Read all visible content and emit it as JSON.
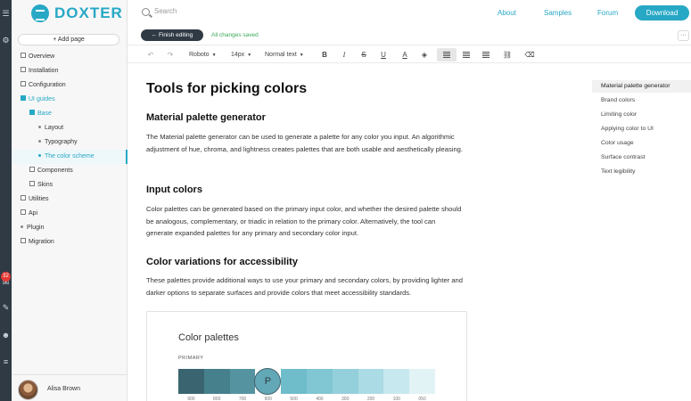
{
  "app": {
    "brand": "DOXTER"
  },
  "rail": {
    "icons": [
      {
        "name": "menu-icon",
        "glyph": "☰"
      },
      {
        "name": "settings-icon",
        "glyph": "⚙"
      },
      {
        "name": "notifications-icon",
        "glyph": "✉"
      },
      {
        "name": "edit-icon",
        "glyph": "✎"
      },
      {
        "name": "users-icon",
        "glyph": "☻"
      },
      {
        "name": "sliders-icon",
        "glyph": "≡"
      }
    ],
    "badge": "32"
  },
  "sidebar": {
    "add_page": "+ Add page",
    "items": [
      {
        "label": "Overview",
        "kind": "box"
      },
      {
        "label": "Installation",
        "kind": "box"
      },
      {
        "label": "Configuration",
        "kind": "box"
      },
      {
        "label": "UI guides",
        "kind": "box-active",
        "state": "on"
      },
      {
        "label": "Base",
        "kind": "box-active",
        "state": "on"
      },
      {
        "label": "Layout",
        "kind": "dot"
      },
      {
        "label": "Typography",
        "kind": "dot"
      },
      {
        "label": "The color scheme",
        "kind": "dot",
        "state": "selected"
      },
      {
        "label": "Components",
        "kind": "box"
      },
      {
        "label": "Skins",
        "kind": "box"
      },
      {
        "label": "Utilities",
        "kind": "box"
      },
      {
        "label": "Api",
        "kind": "box"
      },
      {
        "label": "Plugin",
        "kind": "dot"
      },
      {
        "label": "Migration",
        "kind": "box"
      }
    ],
    "user": {
      "name": "Alisa Brown"
    }
  },
  "header": {
    "search_placeholder": "Search",
    "links": [
      "About",
      "Samples",
      "Forum"
    ],
    "download": "Download"
  },
  "subbar": {
    "finish": "← Finish editing",
    "saved": "All changes saved",
    "more": "···"
  },
  "toolbar": {
    "undo": "↶",
    "redo": "↷",
    "font": "Roboto",
    "size": "14px",
    "block": "Normal text",
    "bold": "B",
    "italic": "I",
    "strike": "S",
    "underline": "U",
    "color": "A",
    "fill": "◈",
    "link": "⛓",
    "eraser": "⌫"
  },
  "doc": {
    "title": "Tools for picking colors",
    "sections": [
      {
        "heading": "Material palette generator",
        "text": "The Material palette generator can be used to generate a palette for any color you input. An algorithmic adjustment of hue, chroma, and lightness creates palettes that are both usable and aesthetically pleasing."
      },
      {
        "heading": "Input colors",
        "text": "Color palettes can be generated based on the primary input color, and whether the desired palette should be analogous, complementary, or triadic in relation to the primary color. Alternatively, the tool can generate expanded palettes for any primary and secondary color input."
      },
      {
        "heading": "Color variations for accessibility",
        "text": "These palettes provide additional ways to use your primary and secondary colors, by providing lighter and darker options to separate surfaces and provide colors that meet accessibility standards."
      }
    ],
    "palette": {
      "title": "Color palettes",
      "subtitle": "PRIMARY",
      "primary_marker": "P",
      "swatches": [
        {
          "color": "#3a6470",
          "label": "900"
        },
        {
          "color": "#46808c",
          "label": "800"
        },
        {
          "color": "#5593a0",
          "label": "700"
        },
        {
          "color": "#62a8b6",
          "label": "600",
          "primary": true
        },
        {
          "color": "#6fbccb",
          "label": "500"
        },
        {
          "color": "#80c6d3",
          "label": "400"
        },
        {
          "color": "#94d0db",
          "label": "300"
        },
        {
          "color": "#abdbe4",
          "label": "200"
        },
        {
          "color": "#c7e8ee",
          "label": "100"
        },
        {
          "color": "#e2f3f6",
          "label": "050"
        }
      ]
    }
  },
  "toc": {
    "items": [
      {
        "label": "Material palette generator",
        "active": true
      },
      {
        "label": "Brand colors"
      },
      {
        "label": "Limiting color"
      },
      {
        "label": "Applying color to UI"
      },
      {
        "label": "Color usage"
      },
      {
        "label": "Surface contrast"
      },
      {
        "label": "Text legibility"
      }
    ]
  },
  "colors": {
    "accent": "#27a8c5",
    "rail": "#2f3a45",
    "saved": "#3aa757",
    "badge": "#e53935"
  }
}
